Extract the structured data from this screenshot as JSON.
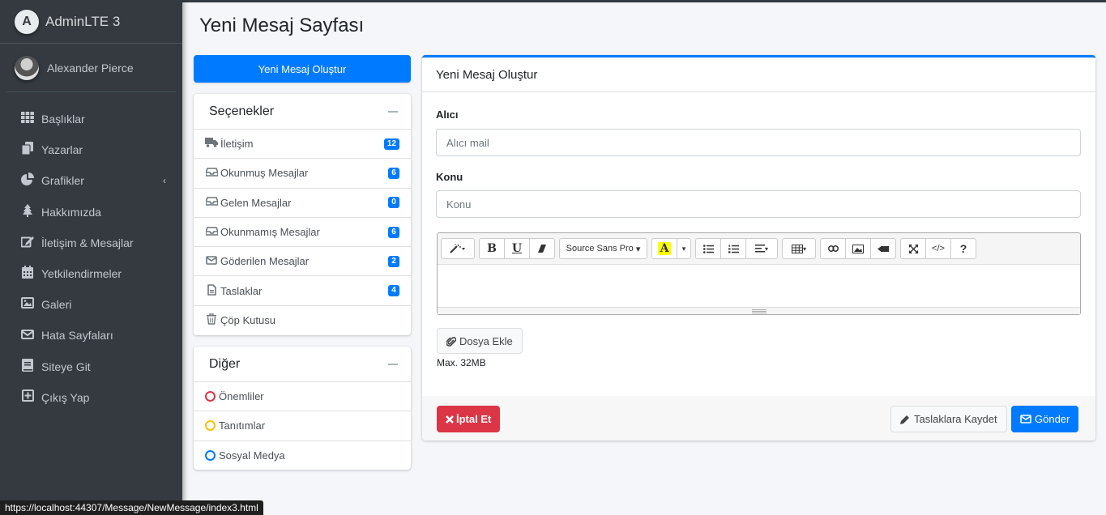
{
  "brand": {
    "logo_letter": "A",
    "name": "AdminLTE 3"
  },
  "user": {
    "name": "Alexander Pierce"
  },
  "sidebar": {
    "items": [
      {
        "label": "Başlıklar",
        "icon": "th-icon"
      },
      {
        "label": "Yazarlar",
        "icon": "copy-icon"
      },
      {
        "label": "Grafikler",
        "icon": "chart-pie-icon",
        "chevron": "‹"
      },
      {
        "label": "Hakkımızda",
        "icon": "tree-icon"
      },
      {
        "label": "İletişim & Mesajlar",
        "icon": "edit-icon"
      },
      {
        "label": "Yetkilendirmeler",
        "icon": "calendar-icon"
      },
      {
        "label": "Galeri",
        "icon": "image-icon"
      },
      {
        "label": "Hata Sayfaları",
        "icon": "envelope-icon"
      },
      {
        "label": "Siteye Git",
        "icon": "book-icon"
      },
      {
        "label": "Çıkış Yap",
        "icon": "plus-square-icon"
      }
    ]
  },
  "page": {
    "title": "Yeni Mesaj Sayfası"
  },
  "compose_button": "Yeni Mesaj Oluştur",
  "folders": {
    "title": "Seçenekler",
    "items": [
      {
        "label": "İletişim",
        "icon": "shipping-icon",
        "count": "12"
      },
      {
        "label": "Okunmuş Mesajlar",
        "icon": "inbox-icon",
        "count": "6"
      },
      {
        "label": "Gelen Mesajlar",
        "icon": "inbox-icon",
        "count": "0"
      },
      {
        "label": "Okunmamış Mesajlar",
        "icon": "inbox-icon",
        "count": "6"
      },
      {
        "label": "Göderilen Mesajlar",
        "icon": "envelope-icon",
        "count": "2"
      },
      {
        "label": "Taslaklar",
        "icon": "file-icon",
        "count": "4"
      },
      {
        "label": "Çöp Kutusu",
        "icon": "trash-icon",
        "count": ""
      }
    ]
  },
  "labels": {
    "title": "Diğer",
    "items": [
      {
        "label": "Önemliler",
        "color": "#dc3545"
      },
      {
        "label": "Tanıtımlar",
        "color": "#ffc107"
      },
      {
        "label": "Sosyal Medya",
        "color": "#007bff"
      }
    ]
  },
  "compose": {
    "header": "Yeni Mesaj Oluştur",
    "to_label": "Alıcı",
    "to_placeholder": "Alıcı mail",
    "subject_label": "Konu",
    "subject_placeholder": "Konu",
    "toolbar": {
      "font_name": "Source Sans Pro",
      "bold": "B",
      "underline": "U",
      "color_letter": "A",
      "help": "?",
      "code": "</>"
    },
    "attach_label": "Dosya Ekle",
    "attach_help": "Max. 32MB",
    "cancel_label": "İptal Et",
    "draft_label": "Taslaklara Kaydet",
    "send_label": "Gönder"
  },
  "status_url": "https://localhost:44307/Message/NewMessage/index3.html",
  "colors": {
    "primary": "#007bff",
    "danger": "#dc3545",
    "sidebar": "#343a40"
  }
}
